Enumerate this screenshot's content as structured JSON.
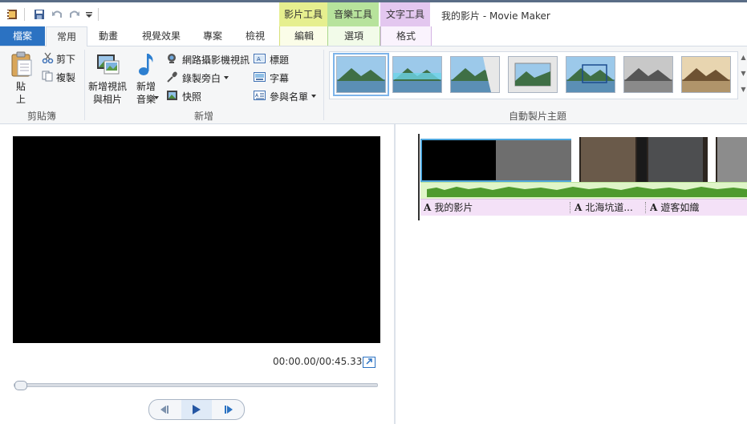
{
  "window": {
    "title": "我的影片 - Movie Maker"
  },
  "context_tabs": {
    "video_tools": "影片工具",
    "music_tools": "音樂工具",
    "text_tools": "文字工具"
  },
  "tabs": [
    "檔案",
    "常用",
    "動畫",
    "視覺效果",
    "專案",
    "檢視"
  ],
  "context_subtabs": {
    "edit": "編輯",
    "options": "選項",
    "format": "格式"
  },
  "ribbon": {
    "clipboard": {
      "paste": "貼上",
      "cut": "剪下",
      "copy": "複製",
      "group": "剪貼簿"
    },
    "add": {
      "add_video": "新增視訊與相片",
      "add_music": "新增音樂",
      "webcam": "網路攝影機視訊",
      "narration": "錄製旁白",
      "snapshot": "快照",
      "title": "標題",
      "caption": "字幕",
      "credits": "參與名單",
      "group": "新增"
    },
    "themes": {
      "group": "自動製片主題"
    }
  },
  "player": {
    "time": "00:00.00/00:45.33",
    "progress": 0
  },
  "storyboard": {
    "captions": [
      "我的影片",
      "北海坑道...",
      "遊客如織"
    ]
  },
  "colors": {
    "file_tab": "#2b72c2",
    "video_tools": "#e6ef8f",
    "music_tools": "#b7e39c",
    "text_tools": "#e3c7ef",
    "selection": "#4ea6dd"
  },
  "icons": [
    "app-icon",
    "save-icon",
    "undo-icon",
    "redo-icon",
    "paste-icon",
    "cut-icon",
    "copy-icon",
    "add-video-icon",
    "add-music-icon",
    "webcam-icon",
    "microphone-icon",
    "snapshot-icon",
    "title-icon",
    "caption-icon",
    "credits-icon",
    "popout-icon",
    "prev-frame-icon",
    "play-icon",
    "next-frame-icon"
  ]
}
